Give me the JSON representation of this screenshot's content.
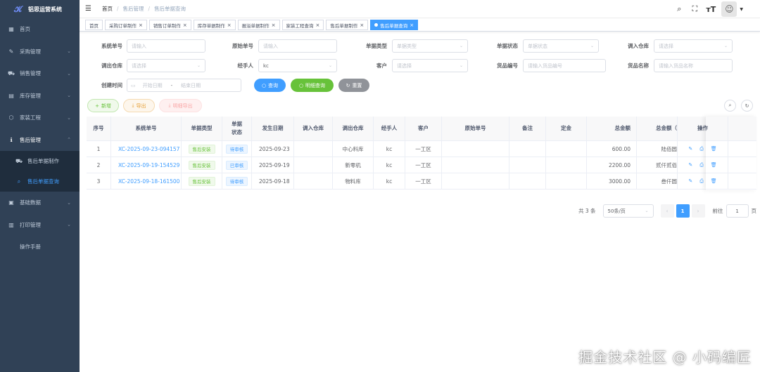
{
  "app": {
    "title": "铝思运营系统"
  },
  "sidebar": {
    "items": [
      {
        "label": "首页",
        "icon": "dashboard-icon",
        "glyph": "▦",
        "chevron": false
      },
      {
        "label": "采购管理",
        "icon": "edit-icon",
        "glyph": "✎",
        "chevron": true
      },
      {
        "label": "销售管理",
        "icon": "cart-icon",
        "glyph": "⛟",
        "chevron": true
      },
      {
        "label": "库存管理",
        "icon": "calendar-icon",
        "glyph": "▤",
        "chevron": true
      },
      {
        "label": "家装工程",
        "icon": "cube-icon",
        "glyph": "⬡",
        "chevron": true
      },
      {
        "label": "售后管理",
        "icon": "info-icon",
        "glyph": "ℹ",
        "chevron": true,
        "open": true,
        "children": [
          {
            "label": "售后单据制作",
            "icon": "cart-icon",
            "glyph": "⛟"
          },
          {
            "label": "售后单据查询",
            "icon": "search-icon",
            "glyph": "⌕",
            "active": true
          }
        ]
      },
      {
        "label": "基础数据",
        "icon": "document-icon",
        "glyph": "▣",
        "chevron": true
      },
      {
        "label": "打印管理",
        "icon": "printer-icon",
        "glyph": "▥",
        "chevron": true
      },
      {
        "label": "操作手册",
        "icon": "",
        "glyph": "",
        "chevron": false
      }
    ]
  },
  "navbar": {
    "breadcrumb": [
      "首页",
      "售后管理",
      "售后单据查询"
    ],
    "right_icons": [
      "search-icon",
      "fullscreen-icon",
      "font-size-icon"
    ]
  },
  "tags": [
    {
      "label": "首页",
      "closable": false
    },
    {
      "label": "采购订单制作",
      "closable": true
    },
    {
      "label": "销售订单制作",
      "closable": true
    },
    {
      "label": "库存单据制作",
      "closable": true
    },
    {
      "label": "报溢单据制作",
      "closable": true
    },
    {
      "label": "家装工程查询",
      "closable": true
    },
    {
      "label": "售后单据制作",
      "closable": true
    },
    {
      "label": "售后单据查询",
      "closable": true,
      "active": true
    }
  ],
  "search": {
    "doc_no": {
      "label": "系统单号",
      "placeholder": "请输入"
    },
    "orig_no": {
      "label": "原始单号",
      "placeholder": "请输入"
    },
    "doc_type": {
      "label": "单据类型",
      "placeholder": "单据类型"
    },
    "doc_status": {
      "label": "单据状态",
      "placeholder": "单据状态"
    },
    "in_wh": {
      "label": "调入仓库",
      "placeholder": "请选择"
    },
    "out_wh": {
      "label": "调出仓库",
      "placeholder": "请选择"
    },
    "handler": {
      "label": "经手人",
      "value": "kc"
    },
    "customer": {
      "label": "客户",
      "placeholder": "请选择"
    },
    "goods_code": {
      "label": "货品编号",
      "placeholder": "请输入货品编号"
    },
    "goods_name": {
      "label": "货品名称",
      "placeholder": "请输入货品名称"
    },
    "created": {
      "label": "创建时间",
      "start": "开始日期",
      "sep": "-",
      "end": "结束日期"
    },
    "query_btn": "查询",
    "detail_btn": "明细查询",
    "reset_btn": "重置"
  },
  "toolbar": {
    "add": "新增",
    "export": "导出",
    "export_detail": "明细导出"
  },
  "table": {
    "columns": [
      "序号",
      "系统单号",
      "单据类型",
      "单据\n状态",
      "发生日期",
      "调入仓库",
      "调出仓库",
      "经手人",
      "客户",
      "原始单号",
      "备注",
      "定金",
      "总金额",
      "总金额（",
      "操作"
    ],
    "rows": [
      {
        "idx": "1",
        "no": "XC-2025-09-23-094157",
        "type": "售后安装",
        "status": "待审核",
        "date": "2025-09-23",
        "in": "",
        "out": "中心料库",
        "handler": "kc",
        "customer": "一工区",
        "orig": "",
        "remark": "",
        "deposit": "",
        "amount": "600.00",
        "amount_cn": "陆佰圆"
      },
      {
        "idx": "2",
        "no": "XC-2025-09-19-154529",
        "type": "售后安装",
        "status": "已审核",
        "date": "2025-09-19",
        "in": "",
        "out": "新零机",
        "handler": "kc",
        "customer": "一工区",
        "orig": "",
        "remark": "",
        "deposit": "",
        "amount": "2200.00",
        "amount_cn": "贰仟贰佰"
      },
      {
        "idx": "3",
        "no": "XC-2025-09-18-161500",
        "type": "售后安装",
        "status": "待审核",
        "date": "2025-09-18",
        "in": "",
        "out": "物料库",
        "handler": "kc",
        "customer": "一工区",
        "orig": "",
        "remark": "",
        "deposit": "",
        "amount": "3000.00",
        "amount_cn": "叁仟圆"
      }
    ]
  },
  "pagination": {
    "total": "共 3 条",
    "page_size": "50条/页",
    "current": "1",
    "goto_label": "前往",
    "goto_value": "1",
    "page_suffix": "页"
  },
  "watermark": "掘金技术社区 @ 小码编匠",
  "colors": {
    "sidebar_bg": "#304156",
    "primary": "#409eff",
    "success": "#67c23a",
    "warning": "#e6a23c",
    "info": "#909399"
  }
}
